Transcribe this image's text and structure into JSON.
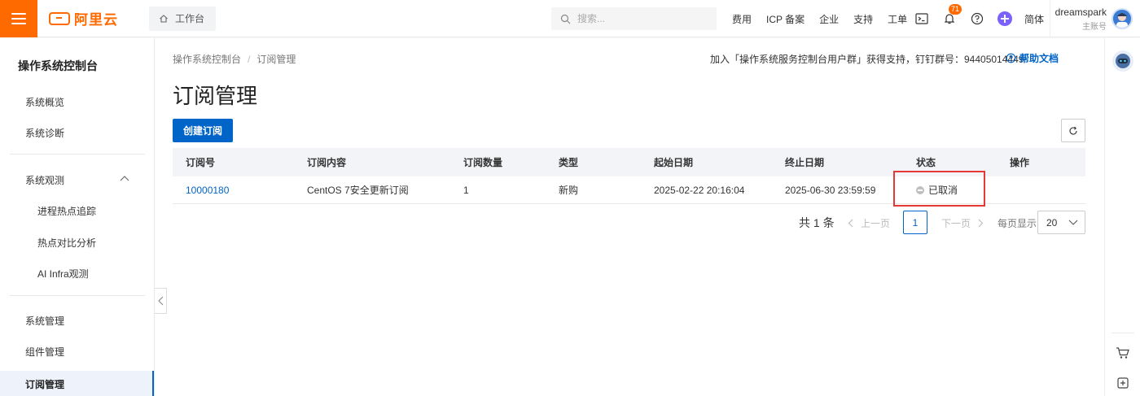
{
  "header": {
    "brand": "阿里云",
    "workbench": "工作台",
    "search_placeholder": "搜索...",
    "nav": [
      "费用",
      "ICP 备案",
      "企业",
      "支持",
      "工单"
    ],
    "notification_count": "71",
    "language": "简体",
    "user_name": "dreamspark",
    "user_role": "主账号"
  },
  "sidebar": {
    "title": "操作系统控制台",
    "overview": "系统概览",
    "diagnosis": "系统诊断",
    "observe": "系统观测",
    "observe_children": [
      "进程热点追踪",
      "热点对比分析",
      "AI Infra观测"
    ],
    "manage": "系统管理",
    "components": "组件管理",
    "subscriptions": "订阅管理"
  },
  "breadcrumb": [
    "操作系统控制台",
    "订阅管理"
  ],
  "notice": "加入「操作系统服务控制台用户群」获得支持，钉钉群号：94405014449",
  "help_label": "帮助文档",
  "page_title": "订阅管理",
  "create_button": "创建订阅",
  "table": {
    "headers": [
      "订阅号",
      "订阅内容",
      "订阅数量",
      "类型",
      "起始日期",
      "终止日期",
      "状态",
      "操作"
    ],
    "rows": [
      {
        "id": "10000180",
        "content": "CentOS 7安全更新订阅",
        "quantity": "1",
        "type": "新购",
        "start": "2025-02-22 20:16:04",
        "end": "2025-06-30 23:59:59",
        "status": "已取消",
        "action": ""
      }
    ]
  },
  "pagination": {
    "total": "共 1 条",
    "prev": "上一页",
    "current": "1",
    "next": "下一页",
    "per_page_label": "每页显示",
    "per_page": "20"
  },
  "colors": {
    "brand_orange": "#ff6a00",
    "primary_blue": "#0064c8",
    "highlight_red": "#e53935"
  }
}
